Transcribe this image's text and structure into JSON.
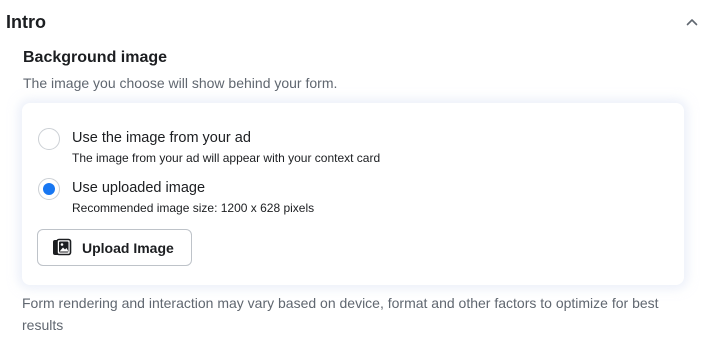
{
  "section": {
    "title": "Intro",
    "collapse_icon": "chevron-up-icon"
  },
  "background_image": {
    "title": "Background image",
    "description": "The image you choose will show behind your form.",
    "options": [
      {
        "label": "Use the image from your ad",
        "sublabel": "The image from your ad will appear with your context card",
        "selected": false
      },
      {
        "label": "Use uploaded image",
        "sublabel": "Recommended image size: 1200 x 628 pixels",
        "selected": true
      }
    ],
    "upload_button": {
      "label": "Upload Image",
      "icon": "image-gallery-icon"
    }
  },
  "footer": {
    "note": "Form rendering and interaction may vary based on device, format and other factors to optimize for best results"
  },
  "colors": {
    "accent": "#1877f2",
    "text_primary": "#1c1e21",
    "text_secondary": "#606770",
    "border": "#bec3c9"
  }
}
